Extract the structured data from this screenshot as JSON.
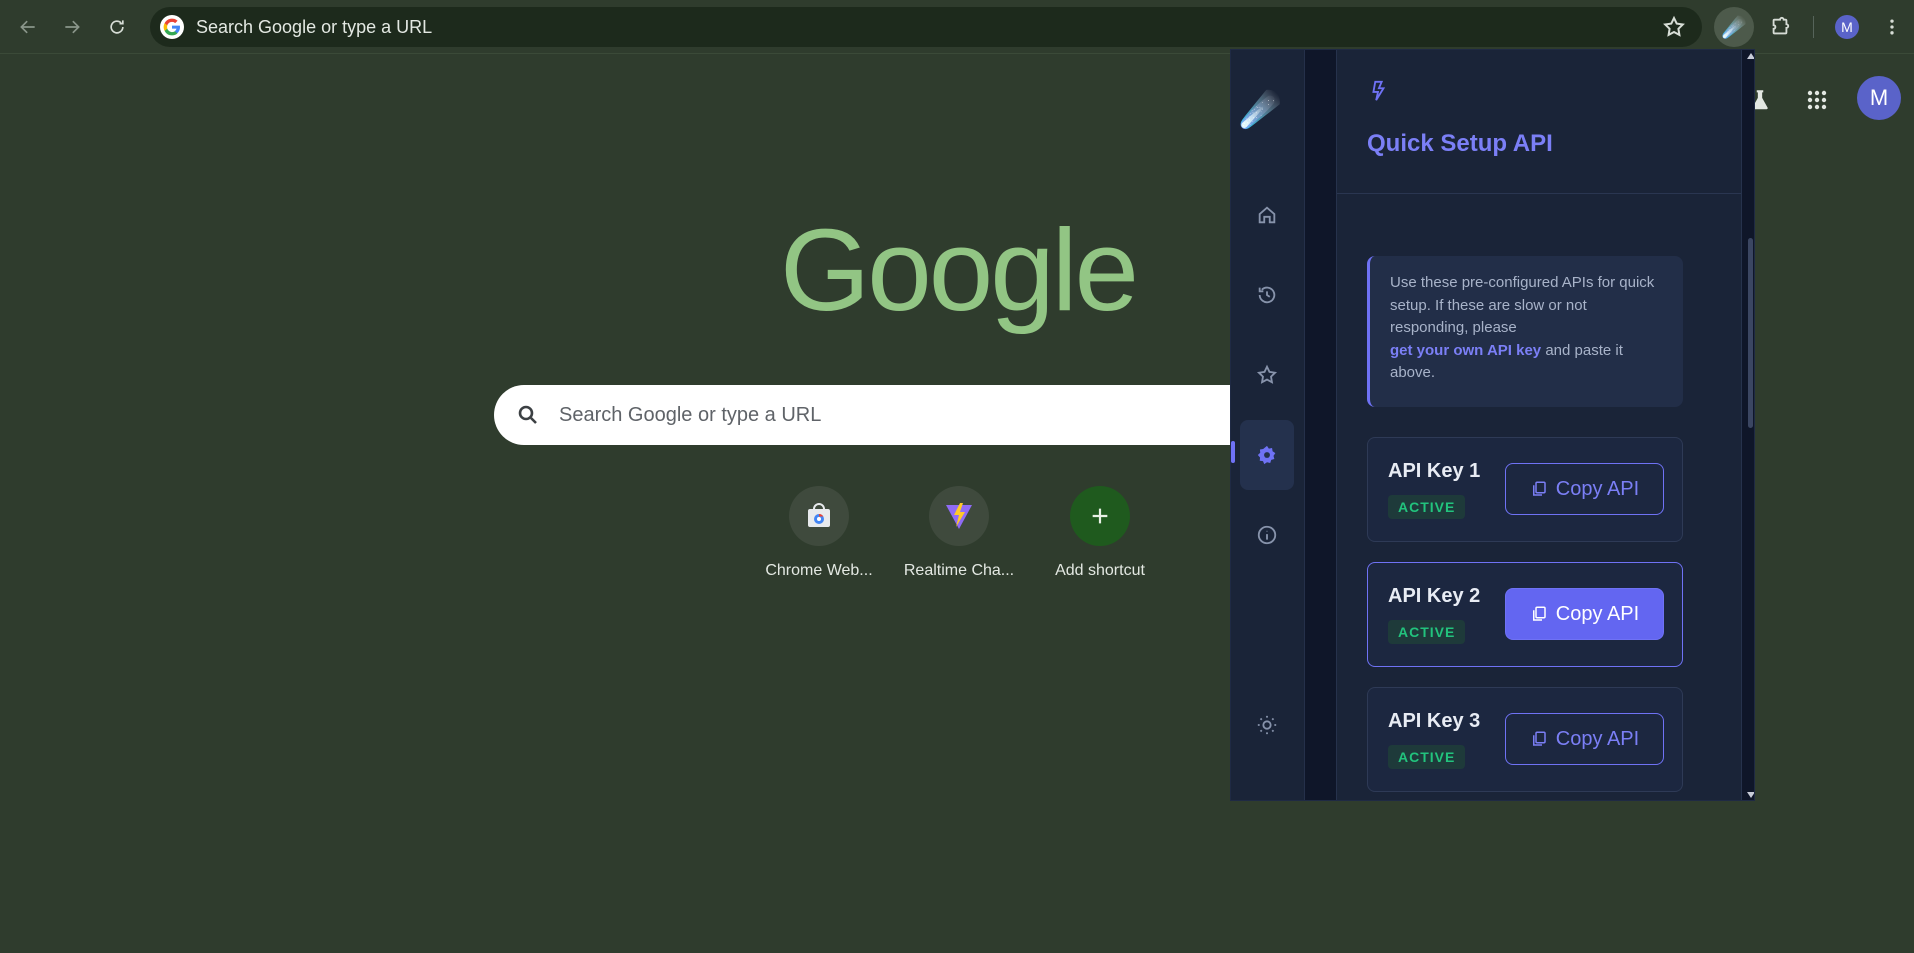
{
  "browser": {
    "omnibox_text": "Search Google or type a URL",
    "profile_initial": "M"
  },
  "ntp": {
    "logo_text": "Google",
    "search_placeholder": "Search Google or type a URL",
    "avatar_initial": "M",
    "shortcuts": [
      {
        "label": "Chrome Web...",
        "icon": "chrome-web-store-icon"
      },
      {
        "label": "Realtime Cha...",
        "icon": "vite-icon"
      },
      {
        "label": "Add shortcut",
        "icon": "plus-icon"
      }
    ]
  },
  "popup": {
    "logo_icon": "☄️",
    "title": "Quick Setup API",
    "info": {
      "text_before": "Use these pre-configured APIs for quick setup. If these are slow or not responding, please",
      "link": "get your own API key",
      "text_after": "and paste it above."
    },
    "copy_label": "Copy API",
    "api_keys": [
      {
        "name": "API Key 1",
        "status": "ACTIVE"
      },
      {
        "name": "API Key 2",
        "status": "ACTIVE"
      },
      {
        "name": "API Key 3",
        "status": "ACTIVE"
      }
    ],
    "rail_items": [
      "home-icon",
      "history-icon",
      "star-icon",
      "settings-icon",
      "info-icon",
      "theme-sun-icon"
    ]
  },
  "colors": {
    "page_bg": "#2f3c2d",
    "accent": "#6f72f5",
    "active_green": "#22c37d",
    "google_logo": "#92c584"
  }
}
